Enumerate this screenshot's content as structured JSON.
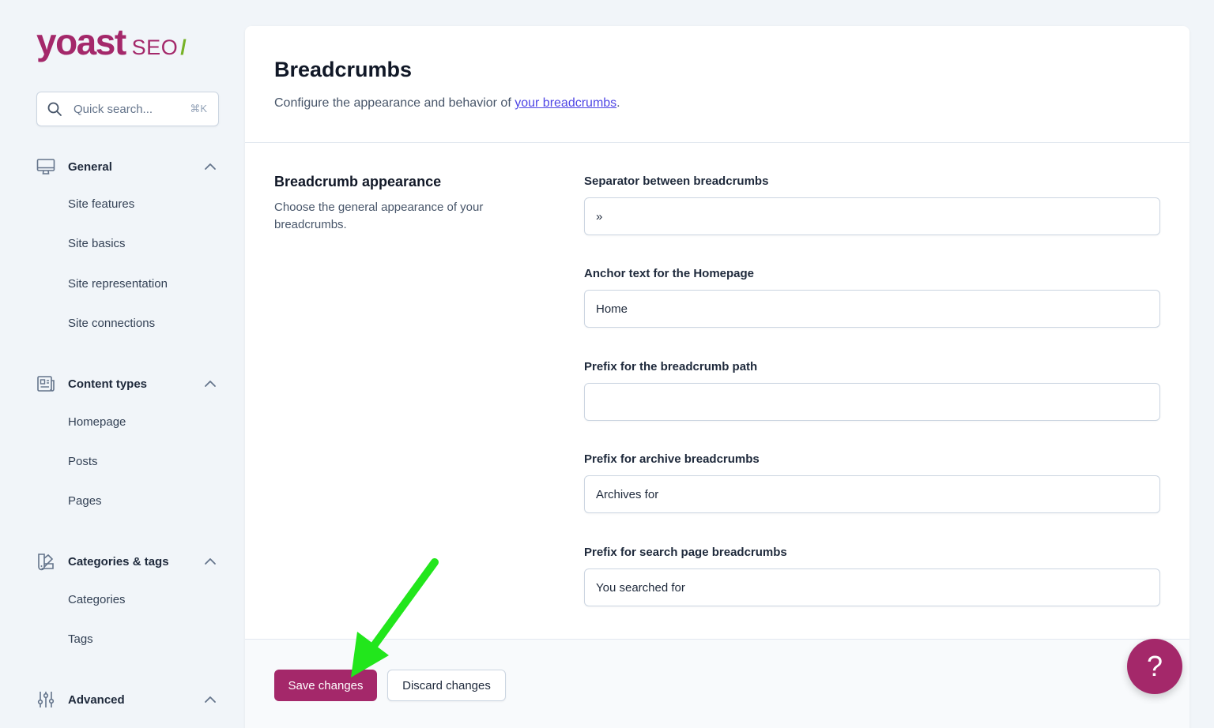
{
  "brand": {
    "name": "yoast",
    "product": "SEO",
    "slash": "/"
  },
  "search": {
    "placeholder": "Quick search...",
    "shortcut": "⌘K"
  },
  "sidebar": {
    "groups": [
      {
        "label": "General",
        "icon": "desktop-icon",
        "items": [
          "Site features",
          "Site basics",
          "Site representation",
          "Site connections"
        ]
      },
      {
        "label": "Content types",
        "icon": "newspaper-icon",
        "items": [
          "Homepage",
          "Posts",
          "Pages"
        ]
      },
      {
        "label": "Categories & tags",
        "icon": "color-swatch-icon",
        "items": [
          "Categories",
          "Tags"
        ]
      },
      {
        "label": "Advanced",
        "icon": "adjustments-icon",
        "items": []
      }
    ]
  },
  "page": {
    "title": "Breadcrumbs",
    "description_prefix": "Configure the appearance and behavior of ",
    "description_link": "your breadcrumbs",
    "description_suffix": "."
  },
  "section": {
    "title": "Breadcrumb appearance",
    "description": "Choose the general appearance of your breadcrumbs."
  },
  "fields": [
    {
      "label": "Separator between breadcrumbs",
      "value": "»"
    },
    {
      "label": "Anchor text for the Homepage",
      "value": "Home"
    },
    {
      "label": "Prefix for the breadcrumb path",
      "value": ""
    },
    {
      "label": "Prefix for archive breadcrumbs",
      "value": "Archives for"
    },
    {
      "label": "Prefix for search page breadcrumbs",
      "value": "You searched for"
    }
  ],
  "footer": {
    "save_label": "Save changes",
    "discard_label": "Discard changes"
  },
  "help": {
    "label": "?"
  },
  "colors": {
    "brand": "#a4286a",
    "accent_green": "#77b227",
    "link": "#4f46e5",
    "annotation_arrow": "#22e61c"
  }
}
